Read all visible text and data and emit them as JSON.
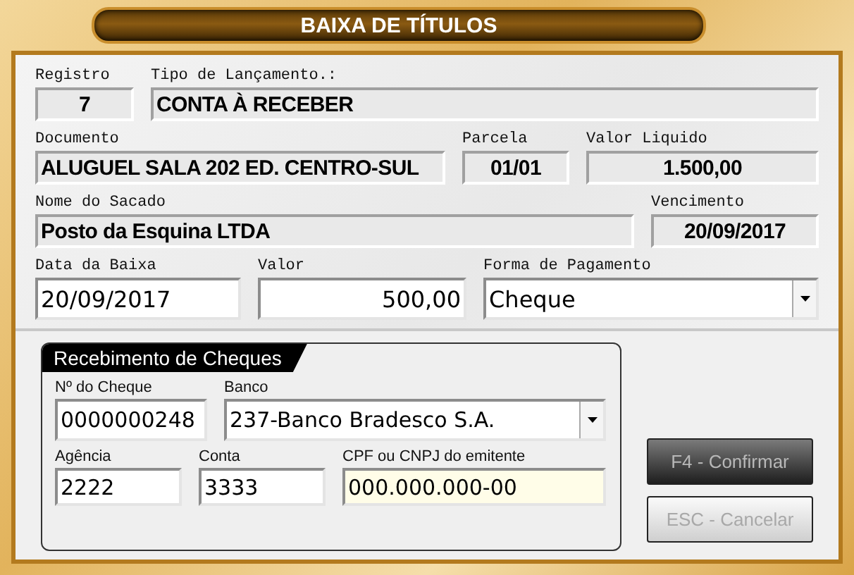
{
  "window": {
    "title": "BAIXA DE TÍTULOS"
  },
  "rows": [
    {
      "fields": [
        {
          "label": "Registro",
          "value": "7",
          "kind": "readonly"
        },
        {
          "label": "Tipo de Lançamento.:",
          "value": "CONTA À RECEBER",
          "kind": "readonly"
        }
      ]
    },
    {
      "fields": [
        {
          "label": "Documento",
          "value": "ALUGUEL SALA 202 ED. CENTRO-SUL",
          "kind": "readonly"
        },
        {
          "label": "Parcela",
          "value": "01/01",
          "kind": "readonly"
        },
        {
          "label": "Valor Liquido",
          "value": "1.500,00",
          "kind": "readonly"
        }
      ]
    },
    {
      "fields": [
        {
          "label": "Nome do Sacado",
          "value": "Posto da Esquina LTDA",
          "kind": "readonly"
        },
        {
          "label": "Vencimento",
          "value": "20/09/2017",
          "kind": "readonly"
        }
      ]
    },
    {
      "fields": [
        {
          "label": "Data da Baixa",
          "value": "20/09/2017",
          "kind": "input"
        },
        {
          "label": "Valor",
          "value": "500,00",
          "kind": "input"
        },
        {
          "label": "Forma de Pagamento",
          "value": "Cheque",
          "kind": "select"
        }
      ]
    }
  ],
  "cheque_group": {
    "title": "Recebimento de Cheques",
    "rows": [
      {
        "fields": [
          {
            "label": "Nº do Cheque",
            "value": "0000000248",
            "kind": "input",
            "focused": false
          },
          {
            "label": "Banco",
            "value": "237-Banco Bradesco S.A.",
            "kind": "select",
            "focused": false
          }
        ]
      },
      {
        "fields": [
          {
            "label": "Agência",
            "value": "2222",
            "kind": "input",
            "focused": false
          },
          {
            "label": "Conta",
            "value": "3333",
            "kind": "input",
            "focused": false
          },
          {
            "label": "CPF ou CNPJ do emitente",
            "value": "000.000.000-00",
            "kind": "input",
            "focused": true
          }
        ]
      }
    ]
  },
  "buttons": [
    {
      "label": "F4 - Confirmar",
      "kind": "dark"
    },
    {
      "label": "ESC - Cancelar",
      "kind": "light"
    }
  ]
}
